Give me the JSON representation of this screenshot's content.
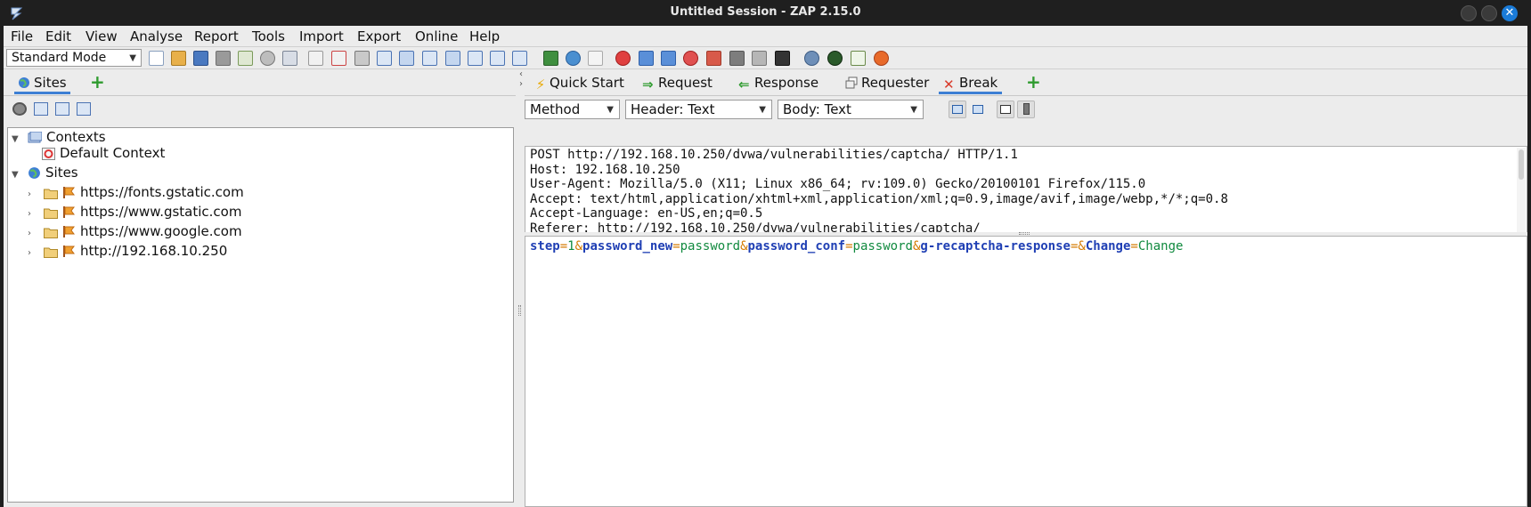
{
  "window": {
    "title": "Untitled Session - ZAP 2.15.0",
    "accent": "#1a7bd8"
  },
  "menu": {
    "items": [
      "File",
      "Edit",
      "View",
      "Analyse",
      "Report",
      "Tools",
      "Import",
      "Export",
      "Online",
      "Help"
    ]
  },
  "toolbar": {
    "mode": "Standard Mode",
    "icons": [
      "new-session-icon",
      "open-session-icon",
      "save-session-icon",
      "snapshot-icon",
      "session-properties-icon",
      "options-icon",
      "export-icon",
      "add-context-icon",
      "remove-context-icon",
      "context-select-icon",
      "layout-full-icon",
      "layout-horizontal-icon",
      "layout-vertical-icon",
      "layout-tabs-icon",
      "layout-side-icon",
      "layout-bottom-icon",
      "layout-split-icon",
      "manage-addons-icon",
      "check-updates-icon",
      "scan-policy-icon",
      "break-toggle-icon",
      "step-icon",
      "continue-icon",
      "drop-icon",
      "filter-icon",
      "console-icon",
      "zest-icon",
      "terminal-icon",
      "hud-icon",
      "record-icon",
      "notes-icon",
      "firefox-icon"
    ]
  },
  "left": {
    "tab_label": "Sites",
    "tree": {
      "contexts_label": "Contexts",
      "default_context": "Default Context",
      "sites_label": "Sites",
      "sites": [
        "https://fonts.gstatic.com",
        "https://www.gstatic.com",
        "https://www.google.com",
        "http://192.168.10.250"
      ]
    }
  },
  "right": {
    "tabs": {
      "quick_start": "Quick Start",
      "request": "Request",
      "response": "Response",
      "requester": "Requester",
      "break": "Break"
    },
    "controls": {
      "method": "Method",
      "header_view": "Header: Text",
      "body_view": "Body: Text"
    },
    "header_lines": [
      "POST http://192.168.10.250/dvwa/vulnerabilities/captcha/ HTTP/1.1",
      "Host: 192.168.10.250",
      "User-Agent: Mozilla/5.0 (X11; Linux x86_64; rv:109.0) Gecko/20100101 Firefox/115.0",
      "Accept: text/html,application/xhtml+xml,application/xml;q=0.9,image/avif,image/webp,*/*;q=0.8",
      "Accept-Language: en-US,en;q=0.5",
      "Referer: http://192.168.10.250/dvwa/vulnerabilities/captcha/"
    ],
    "body": {
      "k1": "step",
      "v1": "1",
      "k2": "password_new",
      "v2": "password",
      "k3": "password_conf",
      "v3": "password",
      "k4": "g-recaptcha-response",
      "v4": "",
      "k5": "Change",
      "v5": "Change"
    }
  }
}
